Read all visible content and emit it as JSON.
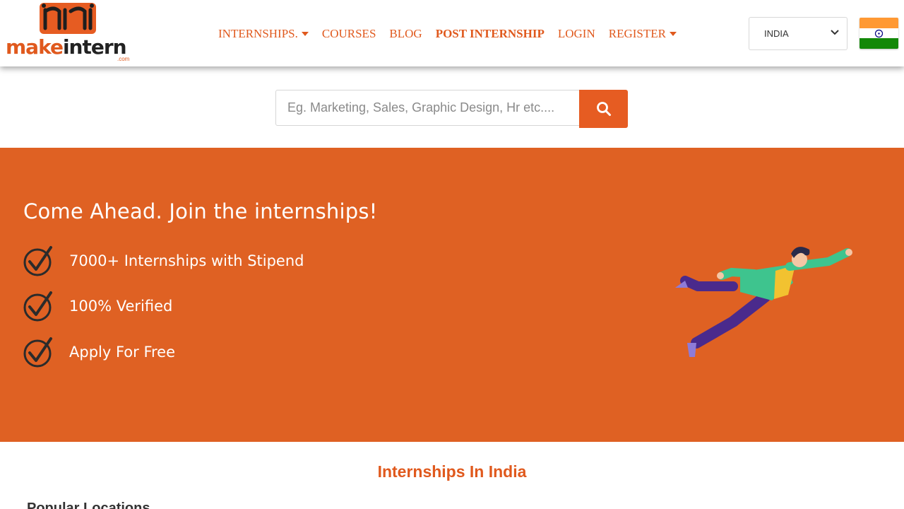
{
  "logo": {
    "text_make": "make",
    "text_intern": "intern",
    "dotcom": ".com"
  },
  "nav": [
    {
      "label": "INTERNSHIPS.",
      "dropdown": true,
      "bold": false
    },
    {
      "label": "COURSES",
      "dropdown": false,
      "bold": false
    },
    {
      "label": "BLOG",
      "dropdown": false,
      "bold": false
    },
    {
      "label": "POST INTERNSHIP",
      "dropdown": false,
      "bold": true
    },
    {
      "label": "LOGIN",
      "dropdown": false,
      "bold": false
    },
    {
      "label": "REGISTER",
      "dropdown": true,
      "bold": false
    }
  ],
  "country": {
    "selected": "INDIA",
    "flag": "india-flag"
  },
  "search": {
    "placeholder": "Eg. Marketing, Sales, Graphic Design, Hr etc....",
    "icon": "search-icon"
  },
  "hero": {
    "title": "Come Ahead. Join the internships!",
    "features": [
      "7000+ Internships with Stipend",
      "100% Verified",
      "Apply For Free"
    ]
  },
  "section": {
    "title": "Internships In India",
    "subheading": "Popular Locations"
  },
  "colors": {
    "accent": "#e0591d",
    "hero_bg": "#df6123",
    "check": "#2b2b2b"
  }
}
